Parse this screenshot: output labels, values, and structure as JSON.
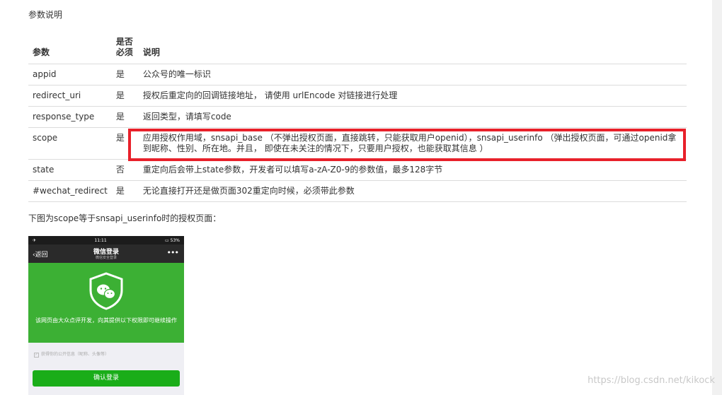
{
  "section_title": "参数说明",
  "table": {
    "headers": [
      "参数",
      "是否必须",
      "说明"
    ],
    "rows": [
      {
        "param": "appid",
        "required": "是",
        "desc": "公众号的唯一标识"
      },
      {
        "param": "redirect_uri",
        "required": "是",
        "desc": "授权后重定向的回调链接地址， 请使用 urlEncode 对链接进行处理"
      },
      {
        "param": "response_type",
        "required": "是",
        "desc": "返回类型，请填写code"
      },
      {
        "param": "scope",
        "required": "是",
        "desc": "应用授权作用域，snsapi_base （不弹出授权页面，直接跳转，只能获取用户openid），snsapi_userinfo （弹出授权页面，可通过openid拿到昵称、性别、所在地。并且， 即使在未关注的情况下，只要用户授权，也能获取其信息 ）"
      },
      {
        "param": "state",
        "required": "否",
        "desc": "重定向后会带上state参数，开发者可以填写a-zA-Z0-9的参数值，最多128字节"
      },
      {
        "param": "#wechat_redirect",
        "required": "是",
        "desc": "无论直接打开还是做页面302重定向时候，必须带此参数"
      }
    ]
  },
  "caption": "下图为scope等于snsapi_userinfo时的授权页面：",
  "phone": {
    "time": "11:11",
    "battery": "53%",
    "back_label": "返回",
    "title": "微信登录",
    "subtitle": "微信安全登录",
    "more": "•••",
    "auth_text": "该网页由大众点评开发，向其提供以下权限即可继续操作",
    "permission": "获得你的公开信息（昵称、头像等）",
    "confirm_label": "确认登录"
  },
  "watermark": "https://blog.csdn.net/kikock",
  "colors": {
    "highlight": "#e8202a",
    "wechat_green": "#3cb034",
    "button_green": "#1aad19"
  }
}
